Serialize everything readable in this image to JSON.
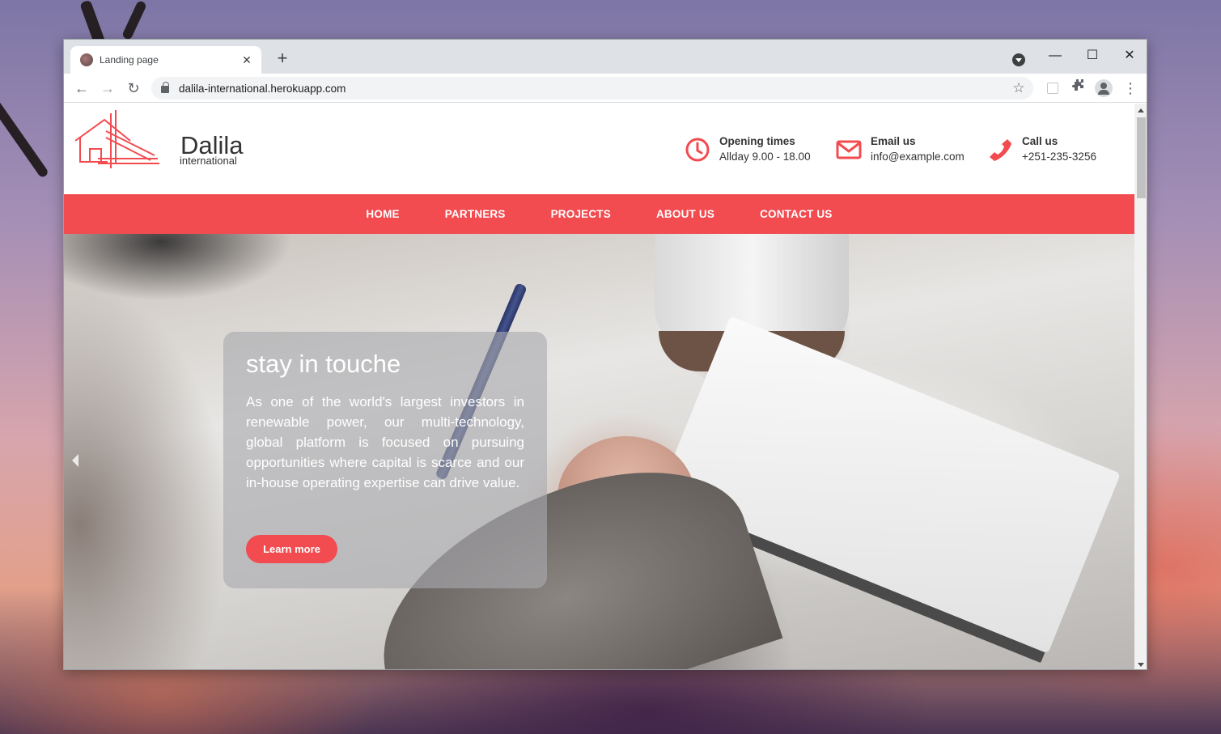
{
  "browser": {
    "tab_title": "Landing page",
    "tab_close": "✕",
    "new_tab": "+",
    "url": "dalila-international.herokuapp.com",
    "window_controls": {
      "minimize": "—",
      "maximize": "☐",
      "close": "✕"
    }
  },
  "site": {
    "logo": {
      "name": "Dalila",
      "sub": "international"
    },
    "info": {
      "hours": {
        "title": "Opening times",
        "value": "Allday 9.00 - 18.00",
        "icon": "clock-icon"
      },
      "email": {
        "title": "Email us",
        "value": "info@example.com",
        "icon": "envelope-icon"
      },
      "phone": {
        "title": "Call us",
        "value": "+251-235-3256",
        "icon": "phone-icon"
      }
    },
    "nav": [
      "HOME",
      "PARTNERS",
      "PROJECTS",
      "ABOUT US",
      "CONTACT US"
    ],
    "hero": {
      "title": "stay in touche",
      "text": "As one of the world's largest investors in renewable power, our multi-technology, global platform is focused on pursuing opportunities where capital is scarce and our in-house operating expertise can drive value.",
      "button": "Learn more"
    }
  },
  "colors": {
    "brand": "#f24b50",
    "tabstrip": "#dee1e6"
  }
}
